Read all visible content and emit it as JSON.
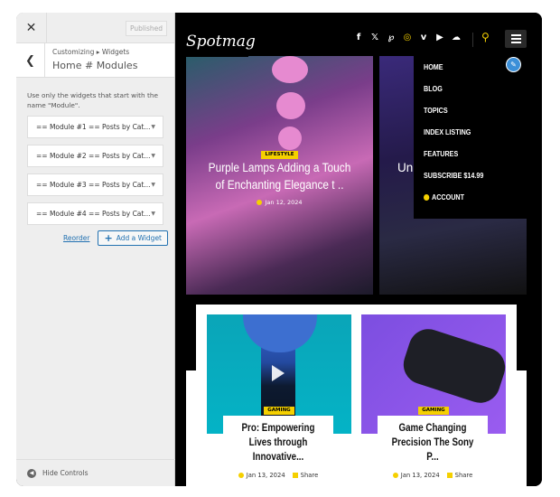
{
  "customizer": {
    "published_label": "Published",
    "breadcrumb": "Customizing ▸ Widgets",
    "section_title": "Home # Modules",
    "description": "Use only the widgets that start with the name \"Module\".",
    "widgets": [
      {
        "label": "== Module #1 == Posts by Cat..."
      },
      {
        "label": "== Module #2 == Posts by Cat..."
      },
      {
        "label": "== Module #3 == Posts by Cat..."
      },
      {
        "label": "== Module #4 == Posts by Cat..."
      }
    ],
    "reorder_label": "Reorder",
    "add_widget_label": "Add a Widget",
    "hide_controls_label": "Hide Controls"
  },
  "site": {
    "logo": "Spotmag",
    "social_icons": [
      "facebook-icon",
      "x-icon",
      "pinterest-icon",
      "instagram-icon",
      "vimeo-icon",
      "youtube-icon",
      "soundcloud-icon"
    ],
    "accent": "#f5d000",
    "menu": [
      "HOME",
      "BLOG",
      "TOPICS",
      "INDEX LISTING",
      "FEATURES",
      "SUBSCRIBE $14.99",
      "ACCOUNT"
    ],
    "hero": [
      {
        "category": "LIFESTYLE",
        "title": "Purple Lamps Adding a Touch of Enchanting Elegance t ..",
        "date": "Jan 12, 2024"
      },
      {
        "title": "Unl"
      }
    ],
    "cards": [
      {
        "category": "GAMING",
        "title": "Pro: Empowering Lives through Innovative...",
        "date": "Jan 13, 2024",
        "share": "Share"
      },
      {
        "category": "GAMING",
        "title": "Game Changing Precision The Sony P...",
        "date": "Jan 13, 2024",
        "share": "Share"
      }
    ]
  }
}
